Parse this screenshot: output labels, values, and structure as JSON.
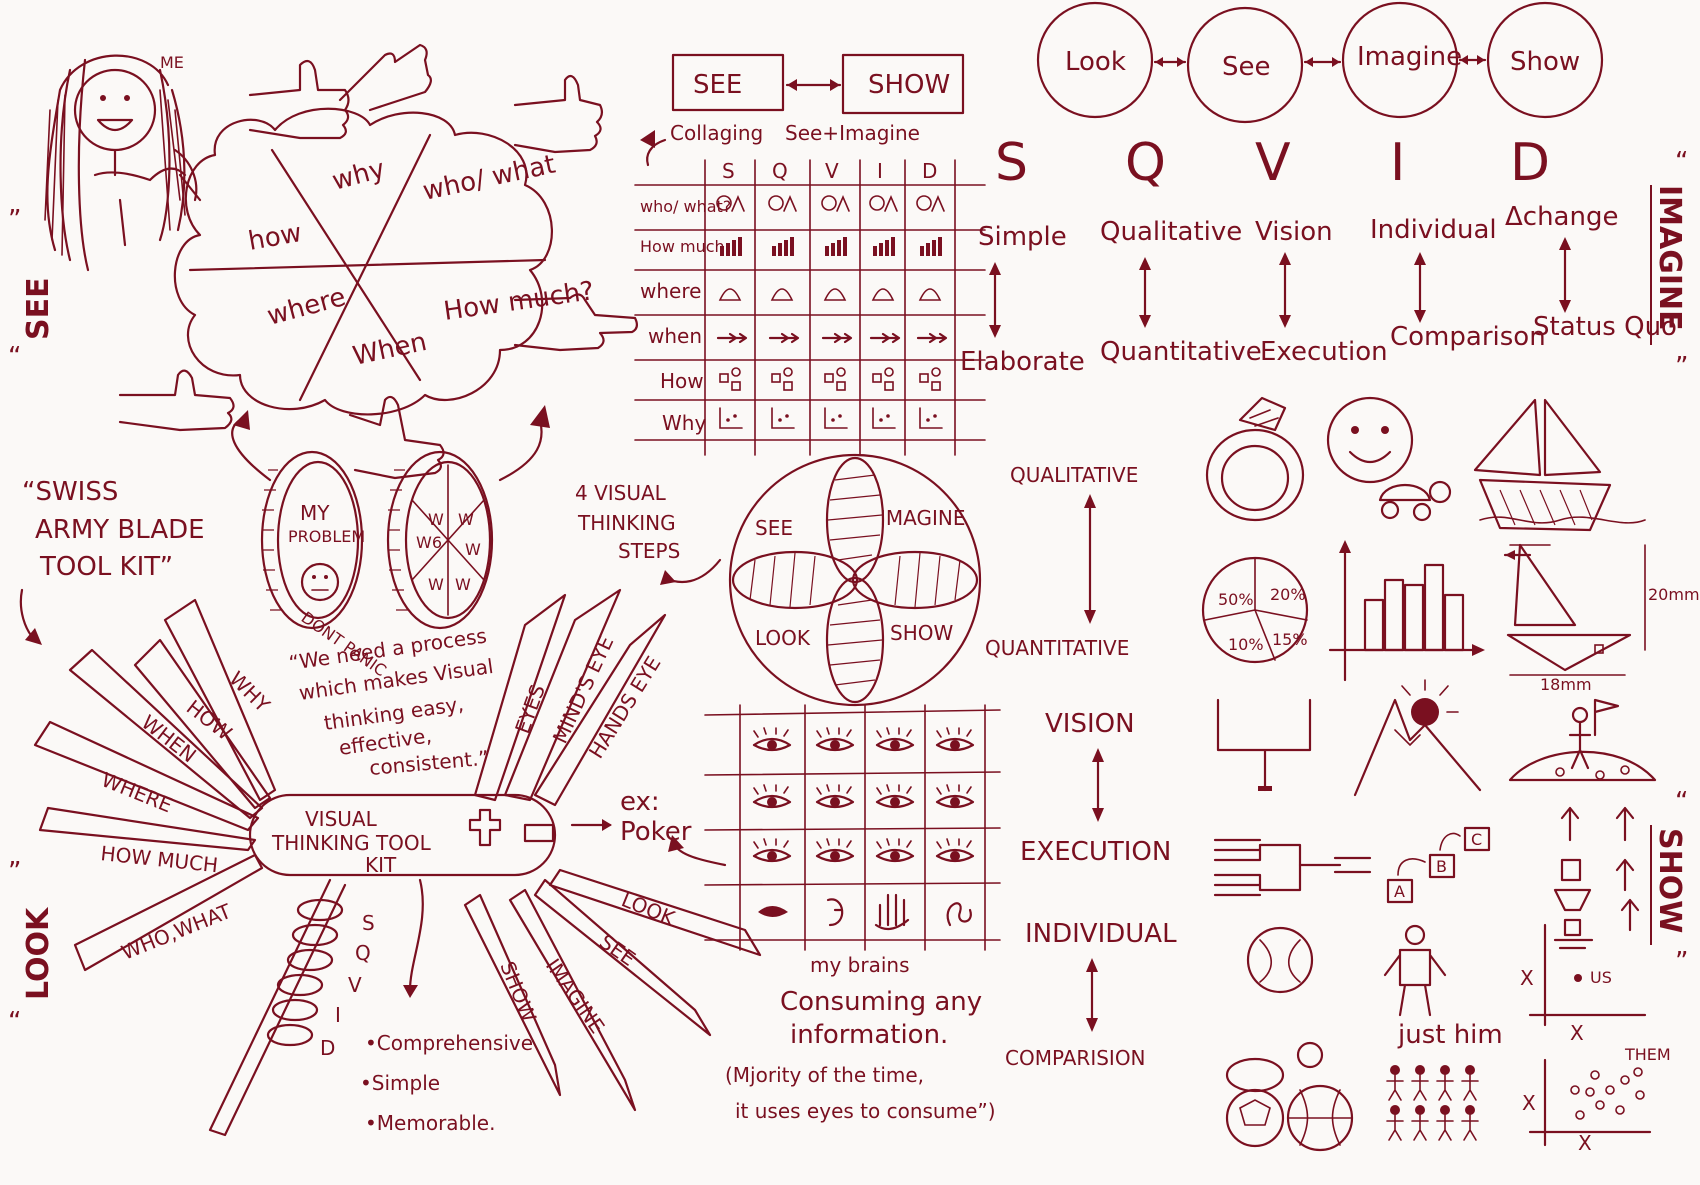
{
  "me_label": "ME",
  "side_labels": {
    "see": "SEE",
    "imagine": "IMAGINE",
    "look": "LOOK",
    "show": "SHOW"
  },
  "quote_mark_left": "“",
  "quote_mark_right": "”",
  "w6_cloud": {
    "why": "why",
    "who_what": "who/ what",
    "how": "how",
    "where": "where",
    "how_much": "How much?",
    "when": "When"
  },
  "coins": {
    "problem_1": "MY",
    "problem_2": "PROBLEM",
    "problem_3": "DONT PANIC",
    "w": "W",
    "w6": "W6"
  },
  "swiss_title": [
    "“SWISS",
    "ARMY BLADE",
    "TOOL KIT”"
  ],
  "process_quote": [
    "“We need a process",
    "which makes Visual",
    "thinking easy,",
    "effective,",
    "consistent.”"
  ],
  "four_steps": [
    "4 VISUAL",
    "THINKING",
    "STEPS"
  ],
  "see_show": {
    "see": "SEE",
    "show": "SHOW",
    "collaging": "Collaging",
    "see_imagine": "See+Imagine"
  },
  "grid": {
    "columns": [
      "S",
      "Q",
      "V",
      "I",
      "D"
    ],
    "rows": [
      "who/ what?",
      "How much",
      "where",
      "when",
      "How",
      "Why"
    ]
  },
  "look_see_chain": [
    "Look",
    "See",
    "Imagine",
    "Show"
  ],
  "sqvid_letters": [
    "S",
    "Q",
    "V",
    "I",
    "D"
  ],
  "sqvid_top": [
    "Simple",
    "Qualitative",
    "Vision",
    "Individual",
    "Δchange"
  ],
  "sqvid_bottom": [
    "Elaborate",
    "Quantitative",
    "Execution",
    "Comparison",
    "Status Quo"
  ],
  "flower": {
    "see": "SEE",
    "imagine": "IMAGINE",
    "look": "LOOK",
    "show": "SHOW"
  },
  "blades_left": [
    "WHY",
    "HOW",
    "WHEN",
    "WHERE",
    "HOW MUCH",
    "WHO,WHAT"
  ],
  "blades_right_top": [
    "EYES",
    "MIND'S EYE",
    "HANDS EYE"
  ],
  "blades_right_bottom": [
    "LOOK",
    "SEE",
    "IMAGINE",
    "SHOW"
  ],
  "toolkit": [
    "VISUAL",
    "THINKING TOOL",
    "KIT"
  ],
  "sqvid_vertical": [
    "S",
    "Q",
    "V",
    "I",
    "D"
  ],
  "ex_poker": [
    "ex:",
    "Poker"
  ],
  "bullets": [
    "•Comprehensive",
    "•Simple",
    "•Memorable."
  ],
  "brain_note": [
    "my brains",
    "Consuming any",
    "information.",
    "(Mjority of the time,",
    "it uses eyes to consume”)"
  ],
  "mid_column": [
    "QUALITATIVE",
    "QUANTITATIVE",
    "VISION",
    "EXECUTION",
    "INDIVIDUAL",
    "COMPARISION"
  ],
  "pie_values": [
    "50%",
    "20%",
    "15%",
    "10%"
  ],
  "dims": {
    "height": "20mm",
    "width": "18mm"
  },
  "abc": [
    "A",
    "B",
    "C"
  ],
  "just_him": "just him",
  "us": "US",
  "them": "THEM",
  "axis_x": "X",
  "ink_color": "#7a1020"
}
